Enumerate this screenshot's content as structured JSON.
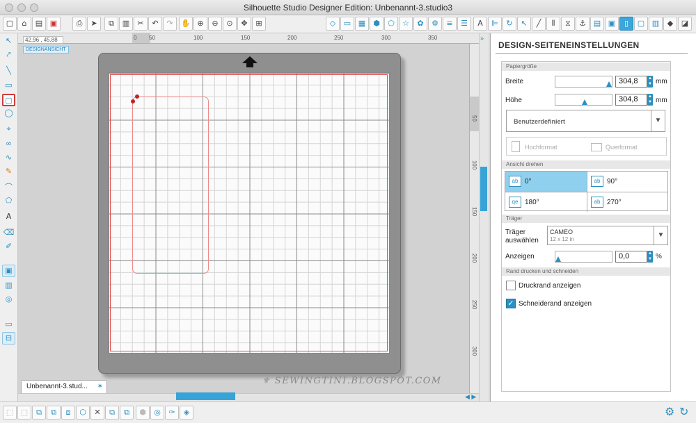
{
  "window": {
    "title": "Silhouette Studio Designer Edition: Unbenannt-3.studio3"
  },
  "toolbar": {
    "icons": [
      "new-icon",
      "open-icon",
      "save-icon",
      "save-as-icon",
      "print-icon",
      "send-icon",
      "copy-icon",
      "paste-icon",
      "cut-icon",
      "undo-icon",
      "redo-icon",
      "pan-icon",
      "zoom-in-icon",
      "zoom-out-icon",
      "zoom-select-icon",
      "fit-page-icon",
      "fill-icon",
      "line-icon",
      "transparency-icon",
      "shape-icon",
      "pentagon-icon",
      "star-icon",
      "flower-icon",
      "settings-shape-icon",
      "line-color-icon",
      "line-style-icon",
      "text-icon",
      "align-icon",
      "rotate-icon",
      "cursor-icon",
      "transform-icon",
      "replicate-icon",
      "modify-icon",
      "trace-icon",
      "library-icon",
      "store-icon",
      "design-page-icon",
      "cut-settings-icon",
      "send-to-silhouette-icon",
      "send-dark-icon"
    ]
  },
  "ruler": {
    "h_ticks": [
      "0",
      "50",
      "100",
      "150",
      "200",
      "250",
      "300",
      "350"
    ],
    "v_ticks": [
      "50",
      "100",
      "150",
      "200",
      "250",
      "300"
    ]
  },
  "coords": "42,96 , 45,88",
  "design_tag": "DESIGNANSICHT",
  "doc_tab": {
    "label": "Unbenannt-3.stud...",
    "pin": "✶"
  },
  "watermark": "⚜ SEWINGTINI.BLOGSPOT.COM",
  "panel": {
    "title": "DESIGN-SEITENEINSTELLUNGEN",
    "paper_section": "Papiergröße",
    "width_label": "Breite",
    "width_value": "304,8",
    "height_label": "Höhe",
    "height_value": "304,8",
    "unit": "mm",
    "size_preset": "Benutzerdefiniert",
    "portrait": "Hochformat",
    "landscape": "Querformat",
    "rotate_section": "Ansicht drehen",
    "rotations": [
      "0°",
      "90°",
      "180°",
      "270°"
    ],
    "carrier_section": "Träger",
    "carrier_label_1": "Träger",
    "carrier_label_2": "auswählen",
    "carrier_name": "CAMEO",
    "carrier_size": "12 x 12 in",
    "show_label": "Anzeigen",
    "show_value": "0,0",
    "percent": "%",
    "border_section": "Rand drucken und schneiden",
    "print_border": "Druckrand anzeigen",
    "print_border_checked": false,
    "cut_border": "Schneiderand anzeigen",
    "cut_border_checked": true
  },
  "colors": {
    "accent": "#2d8fc0",
    "selection": "#8fd0ee",
    "mat": "#8f8f8f",
    "cut_frame": "#e14b4b"
  }
}
